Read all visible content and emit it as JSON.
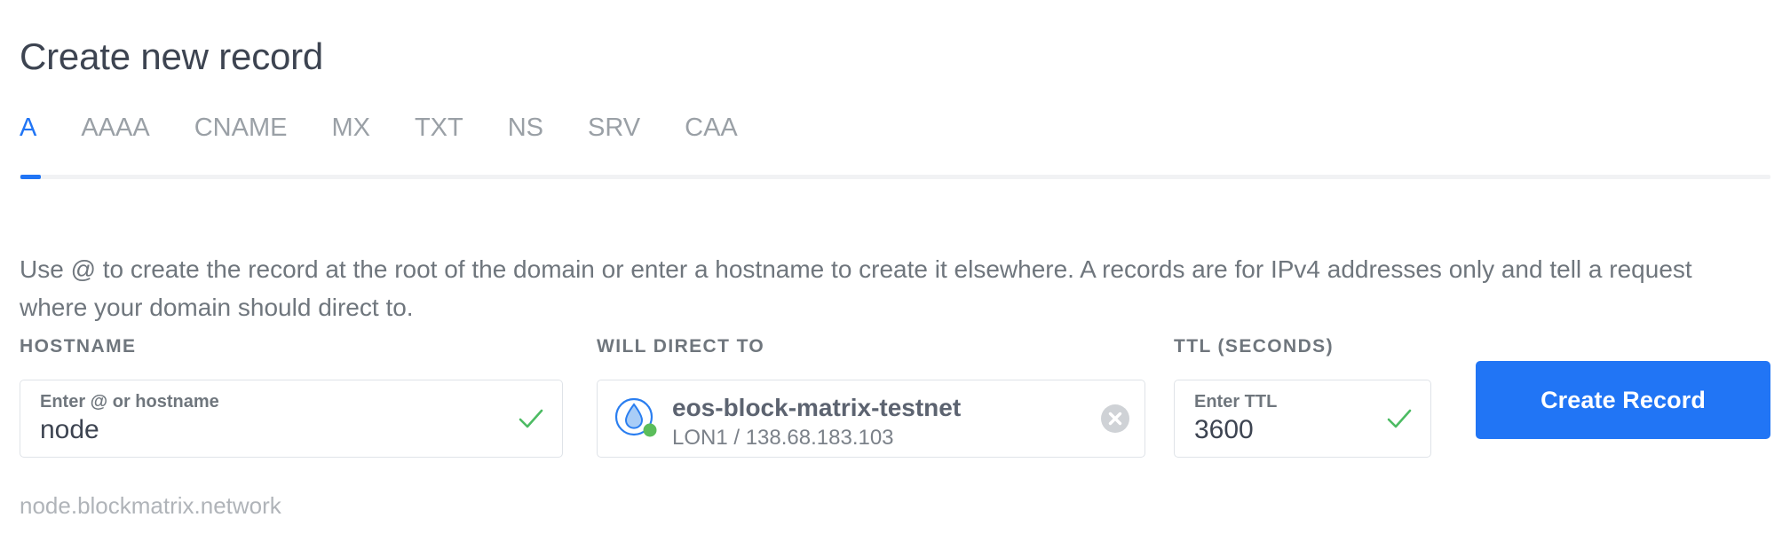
{
  "header": {
    "title": "Create new record"
  },
  "tabs": {
    "items": [
      {
        "label": "A",
        "active": true
      },
      {
        "label": "AAAA",
        "active": false
      },
      {
        "label": "CNAME",
        "active": false
      },
      {
        "label": "MX",
        "active": false
      },
      {
        "label": "TXT",
        "active": false
      },
      {
        "label": "NS",
        "active": false
      },
      {
        "label": "SRV",
        "active": false
      },
      {
        "label": "CAA",
        "active": false
      }
    ],
    "active_label": "A"
  },
  "description": "Use @ to create the record at the root of the domain or enter a hostname to create it elsewhere. A records are for IPv4 addresses only and tell a request where your domain should direct to.",
  "form": {
    "hostname": {
      "label": "HOSTNAME",
      "placeholder": "Enter @ or hostname",
      "value": "node",
      "valid_icon": "check-icon"
    },
    "direct_to": {
      "label": "WILL DIRECT TO",
      "droplet_name": "eos-block-matrix-testnet",
      "droplet_meta": "LON1 / 138.68.183.103",
      "resource_icon": "droplet-icon",
      "status": "active",
      "clear_icon": "clear-circle-icon"
    },
    "ttl": {
      "label": "TTL (SECONDS)",
      "placeholder": "Enter TTL",
      "value": "3600",
      "valid_icon": "check-icon"
    },
    "submit_label": "Create Record"
  },
  "helper_text": "node.blockmatrix.network",
  "colors": {
    "accent_blue": "#2175f5",
    "valid_green": "#4cbb63",
    "status_green": "#5bbd5b",
    "droplet_blue": "#2a7ef0",
    "droplet_fill": "#a9cdf7",
    "text_dark": "#3d4451",
    "text_muted": "#6f767d",
    "tab_inactive": "#9aa0a6",
    "border": "#dfe3e8",
    "helper_grey": "#b0b4b9",
    "clear_grey": "#cfd2d6"
  }
}
